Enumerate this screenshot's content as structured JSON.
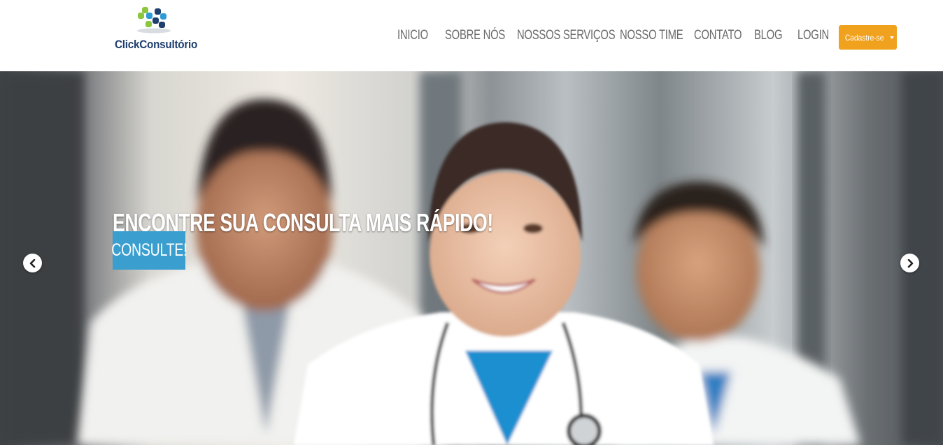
{
  "brand": {
    "name": "ClickConsultório",
    "logo_icon": "puzzle-cross-logo",
    "colors": {
      "navy": "#1f3f6e",
      "green": "#8cc63f",
      "blue": "#2e9bd6"
    }
  },
  "nav": {
    "items": [
      {
        "label": "INICIO"
      },
      {
        "label": "SOBRE NÓS"
      },
      {
        "label": "NOSSOS SERVIÇOS"
      },
      {
        "label": "NOSSO TIME"
      },
      {
        "label": "CONTATO"
      },
      {
        "label": "BLOG"
      },
      {
        "label": "LOGIN"
      }
    ],
    "signup_label": "Cadastre-se",
    "signup_color": "#f0a11e",
    "signup_icon": "caret-down-icon"
  },
  "hero": {
    "title": "ENCONTRE SUA CONSULTA MAIS RÁPIDO!",
    "cta_label": "CONSULTE!",
    "cta_color": "#3a9fcf",
    "prev_icon": "chevron-left-icon",
    "next_icon": "chevron-right-icon",
    "background_subject": "three-doctors-photo"
  }
}
